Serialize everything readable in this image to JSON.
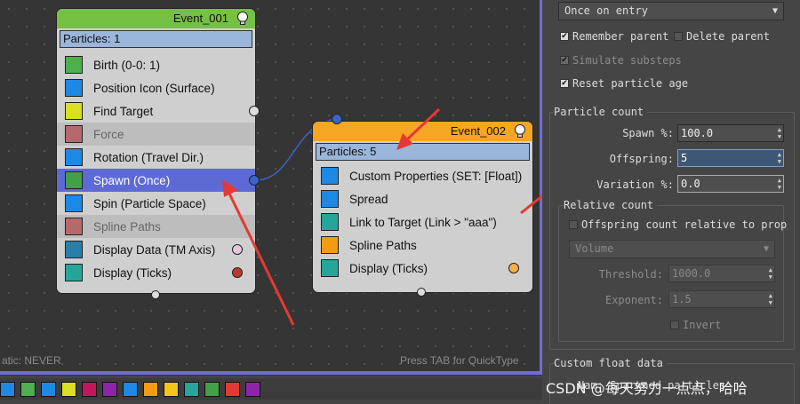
{
  "canvas": {
    "status_left": "atic: NEVER",
    "status_right": "Press TAB for QuickType"
  },
  "event_001": {
    "title": "Event_001",
    "subtitle": "Particles: 1",
    "operators": [
      {
        "label": "Birth (0-0: 1)",
        "icon": "birth-icon"
      },
      {
        "label": "Position Icon (Surface)",
        "icon": "position-icon"
      },
      {
        "label": "Find Target",
        "icon": "find-target-icon"
      },
      {
        "label": "Force",
        "icon": "force-icon"
      },
      {
        "label": "Rotation (Travel Dir.)",
        "icon": "rotation-icon"
      },
      {
        "label": "Spawn (Once)",
        "icon": "spawn-icon"
      },
      {
        "label": "Spin (Particle Space)",
        "icon": "spin-icon"
      },
      {
        "label": "Spline Paths",
        "icon": "spline-paths-icon"
      },
      {
        "label": "Display Data (TM Axis)",
        "icon": "display-data-icon"
      },
      {
        "label": "Display (Ticks)",
        "icon": "display-ticks-icon"
      }
    ],
    "header_color": "#76c043"
  },
  "event_002": {
    "title": "Event_002",
    "subtitle": "Particles: 5",
    "operators": [
      {
        "label": "Custom Properties (SET: [Float])",
        "icon": "custom-properties-icon"
      },
      {
        "label": "Spread",
        "icon": "spread-icon"
      },
      {
        "label": "Link to Target (Link > \"aaa\")",
        "icon": "link-to-target-icon"
      },
      {
        "label": "Spline Paths",
        "icon": "spline-paths-icon"
      },
      {
        "label": "Display (Ticks)",
        "icon": "display-ticks-icon"
      }
    ],
    "header_color": "#f5a623"
  },
  "panel": {
    "mode_select": "Once on entry",
    "remember_parent": "Remember parent",
    "delete_parent": "Delete parent",
    "simulate_substeps": "Simulate substeps",
    "reset_particle_age": "Reset particle age",
    "particle_count_title": "Particle count",
    "spawn_label": "Spawn %:",
    "spawn_value": "100.0",
    "offspring_label": "Offspring:",
    "offspring_value": "5",
    "variation_label": "Variation %:",
    "variation_value": "0.0",
    "relative_count_title": "Relative count",
    "offspring_relative": "Offspring count relative to prop",
    "volume_select": "Volume",
    "threshold_label": "Threshold:",
    "threshold_value": "1000.0",
    "exponent_label": "Exponent:",
    "exponent_value": "1.5",
    "invert_label": "Invert",
    "custom_float_title": "Custom float data",
    "custom_float_field": "Nam: Sparwned particles"
  },
  "watermark": "CSDN @每天努力一点点，哈哈",
  "colors": {
    "accent_arrow": "#e53935",
    "selection": "#5d6ad6",
    "wire": "#3b63c9"
  }
}
